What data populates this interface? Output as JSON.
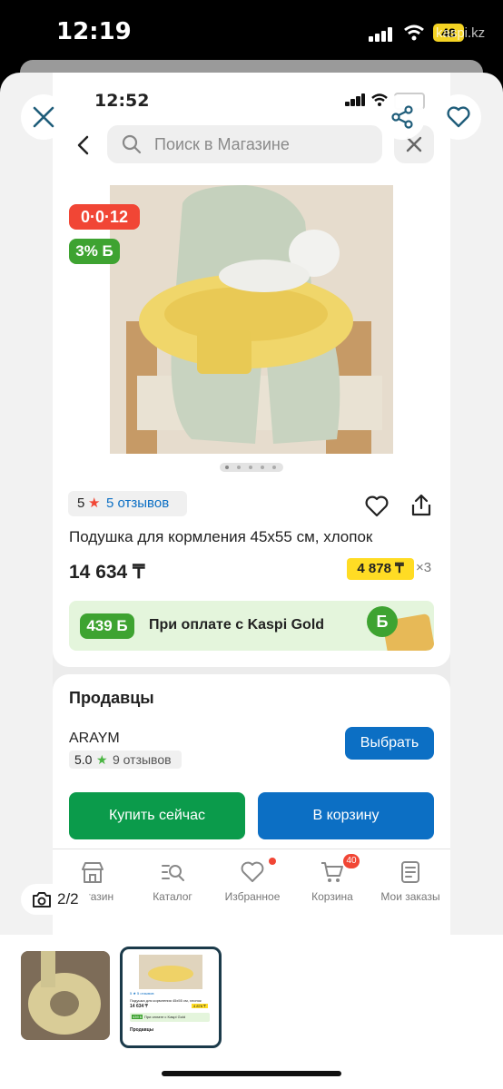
{
  "outer_status": {
    "time": "12:19",
    "carrier": "kaspi.kz",
    "battery": "48"
  },
  "inner_status": {
    "time": "12:52"
  },
  "search": {
    "placeholder": "Поиск в Магазине"
  },
  "badges": {
    "installment": "0·0·12",
    "bonus": "3% Б"
  },
  "gallery": {
    "dots": 5,
    "active": 0
  },
  "rating": {
    "score": "5",
    "reviews": "5 отзывов"
  },
  "product": {
    "title": "Подушка для кормления 45х55 см, хлопок",
    "price": "14 634 ₸",
    "monthly": "4 878 ₸",
    "monthly_mult": "×3"
  },
  "promo": {
    "bonus": "439 Б",
    "text": "При оплате с Kaspi Gold"
  },
  "sellers": {
    "heading": "Продавцы",
    "name": "ARAYM",
    "rating": "5.0",
    "reviews": "9 отзывов",
    "choose": "Выбрать"
  },
  "actions": {
    "buy": "Купить сейчас",
    "cart": "В корзину"
  },
  "nav": {
    "items": [
      {
        "label": "Магазин",
        "icon": "shop-icon"
      },
      {
        "label": "Каталог",
        "icon": "catalog-icon"
      },
      {
        "label": "Избранное",
        "icon": "heart-icon"
      },
      {
        "label": "Корзина",
        "icon": "cart-icon"
      },
      {
        "label": "Мои заказы",
        "icon": "orders-icon"
      }
    ],
    "cart_count": "40"
  },
  "viewer": {
    "counter": "2/2"
  },
  "thumbnail_mini": {
    "rating": "5 ★ 5 отзывов",
    "title": "Подушка для кормления 45х55 см, хлопок",
    "price": "14 634 ₸",
    "monthly": "4 878 ₸",
    "bonus": "439 Б",
    "promo": "При оплате с Kaspi Gold",
    "sellers": "Продавцы"
  },
  "colors": {
    "kaspi_red": "#f14635",
    "green": "#0b9b4b",
    "blue": "#0c6fc4",
    "yellow": "#ffdc24"
  }
}
